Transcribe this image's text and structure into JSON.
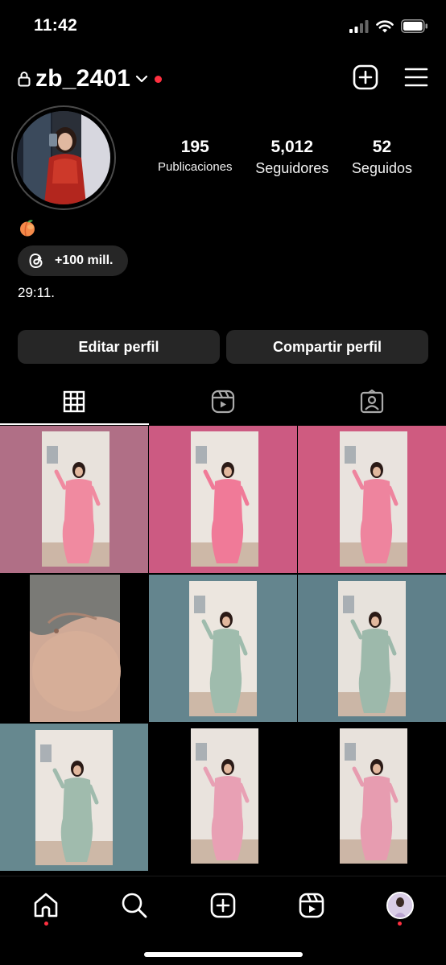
{
  "status_bar": {
    "time": "11:42",
    "icons": [
      "cellular-signal-icon",
      "wifi-icon",
      "battery-icon"
    ]
  },
  "header": {
    "username": "zb_2401",
    "icons": [
      "lock-icon",
      "chevron-down-icon",
      "new-post-icon",
      "menu-icon"
    ],
    "has_notification": true
  },
  "profile": {
    "stats": [
      {
        "value": "195",
        "label": "Publicaciones"
      },
      {
        "value": "5,012",
        "label": "Seguidores"
      },
      {
        "value": "52",
        "label": "Seguidos"
      }
    ],
    "bio_emoji": "peach",
    "threads_badge": "+100 mill.",
    "bio_text": "29:11."
  },
  "buttons": {
    "edit": "Editar perfil",
    "share": "Compartir perfil"
  },
  "tabs": [
    {
      "name": "grid",
      "icon": "grid-icon",
      "active": true
    },
    {
      "name": "reels",
      "icon": "reels-icon",
      "active": false
    },
    {
      "name": "tagged",
      "icon": "tagged-icon",
      "active": false
    }
  ],
  "grid_posts": [
    {
      "bg": "#b06f86",
      "photo_bg": "#e8e2dc",
      "outfit": "#f08aa0"
    },
    {
      "bg": "#cc5a82",
      "photo_bg": "#ebe5df",
      "outfit": "#f07a98"
    },
    {
      "bg": "#cf5b80",
      "photo_bg": "#e9e3de",
      "outfit": "#ee849e"
    },
    {
      "bg": "#000000",
      "photo_bg": "#cfa996",
      "outfit": "#c89b86"
    },
    {
      "bg": "#64858e",
      "photo_bg": "#ece6df",
      "outfit": "#9fbcad"
    },
    {
      "bg": "#5f808a",
      "photo_bg": "#e7e2dc",
      "outfit": "#9db9ab"
    },
    {
      "bg": "#66888f",
      "photo_bg": "#ebe5df",
      "outfit": "#a0bbad"
    },
    {
      "bg": "#000000",
      "photo_bg": "#e9e3dd",
      "outfit": "#e8a0b4"
    },
    {
      "bg": "#000000",
      "photo_bg": "#e8e2dc",
      "outfit": "#e79cb0"
    }
  ],
  "bottom_nav": [
    {
      "name": "home",
      "icon": "home-icon",
      "dot": true
    },
    {
      "name": "search",
      "icon": "search-icon",
      "dot": false
    },
    {
      "name": "create",
      "icon": "create-icon",
      "dot": false
    },
    {
      "name": "reels",
      "icon": "reels-icon",
      "dot": false
    },
    {
      "name": "profile",
      "icon": "profile-avatar",
      "dot": true
    }
  ],
  "colors": {
    "background": "#000000",
    "button_bg": "#262626",
    "notification": "#ff3040"
  }
}
